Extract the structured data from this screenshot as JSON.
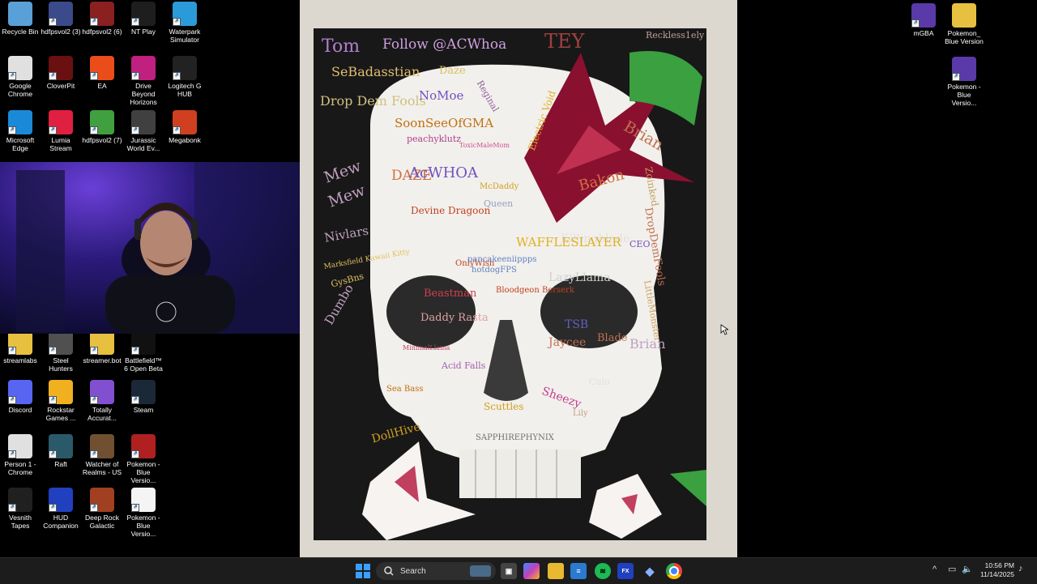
{
  "desktop_left": [
    {
      "label": "Recycle Bin",
      "icon": "recycle-bin-icon",
      "color": "#5aa0d8"
    },
    {
      "label": "hdfpsvol2 (3)",
      "icon": "computer-icon",
      "color": "#3b4a8a"
    },
    {
      "label": "hdfpsvol2 (6)",
      "icon": "ninja-icon",
      "color": "#8a2020"
    },
    {
      "label": "NT Play",
      "icon": "nt-play-icon",
      "color": "#1e1e1e"
    },
    {
      "label": "Waterpark Simulator",
      "icon": "waterpark-icon",
      "color": "#2a9ad8"
    },
    {
      "label": "Google Chrome",
      "icon": "chrome-icon",
      "color": "#e0e0e0"
    },
    {
      "label": "CloverPit",
      "icon": "cloverpit-icon",
      "color": "#6a1010"
    },
    {
      "label": "EA",
      "icon": "ea-icon",
      "color": "#ea4d1a"
    },
    {
      "label": "Drive Beyond Horizons",
      "icon": "drive-beyond-icon",
      "color": "#c02080"
    },
    {
      "label": "Logitech G HUB",
      "icon": "logitech-icon",
      "color": "#222222"
    },
    {
      "label": "Microsoft Edge",
      "icon": "edge-icon",
      "color": "#1a8ad8"
    },
    {
      "label": "Lumia Stream",
      "icon": "lumia-icon",
      "color": "#e02040"
    },
    {
      "label": "hdfpsvol2 (7)",
      "icon": "dragon-icon",
      "color": "#40a040"
    },
    {
      "label": "Jurassic World Ev...",
      "icon": "jurassic-icon",
      "color": "#404040"
    },
    {
      "label": "Megabonk",
      "icon": "megabonk-icon",
      "color": "#d04020"
    },
    {
      "label": "streamlabs",
      "icon": "folder-icon",
      "color": "#e8c040"
    },
    {
      "label": "Steel Hunters",
      "icon": "steel-hunters-icon",
      "color": "#505050"
    },
    {
      "label": "streamer.bot",
      "icon": "folder-icon",
      "color": "#e8c040"
    },
    {
      "label": "Battlefield™ 6 Open Beta",
      "icon": "battlefield-icon",
      "color": "#111111"
    },
    {
      "label": "Discord",
      "icon": "discord-icon",
      "color": "#5865f2"
    },
    {
      "label": "Rockstar Games ...",
      "icon": "rockstar-icon",
      "color": "#f0b020"
    },
    {
      "label": "Totally Accurat...",
      "icon": "tabs-icon",
      "color": "#8050d0"
    },
    {
      "label": "Steam",
      "icon": "steam-icon",
      "color": "#1b2838"
    },
    {
      "label": "Person 1 - Chrome",
      "icon": "chrome-person-icon",
      "color": "#e0e0e0"
    },
    {
      "label": "Raft",
      "icon": "raft-icon",
      "color": "#2a5a6a"
    },
    {
      "label": "Watcher of Realms - US",
      "icon": "watcher-icon",
      "color": "#705030"
    },
    {
      "label": "Pokemon - Blue Versio...",
      "icon": "apex-icon",
      "color": "#b02020"
    },
    {
      "label": "Vesnith Tapes",
      "icon": "vesnith-icon",
      "color": "#202020"
    },
    {
      "label": "HUD Companion",
      "icon": "hud-icon",
      "color": "#2040c0"
    },
    {
      "label": "Deep Rock Galactic",
      "icon": "deep-rock-icon",
      "color": "#a04020"
    },
    {
      "label": "Pokemon - Blue Versio...",
      "icon": "file-icon",
      "color": "#f4f4f4"
    }
  ],
  "desktop_right": [
    {
      "label": "mGBA",
      "icon": "gba-icon",
      "color": "#5a3aa8"
    },
    {
      "label": "Pokemon_ Blue Version",
      "icon": "folder-icon",
      "color": "#e8c040"
    },
    {
      "label": "Pokemon - Blue Versio...",
      "icon": "gba-icon",
      "color": "#5a3aa8"
    }
  ],
  "painting": {
    "signatures": [
      "Tom",
      "Follow @ACWhoa",
      "TEY",
      "Reckless1ely",
      "SeBadasstian",
      "Daze",
      "Reginal",
      "Drop Dem Fools",
      "NoMoe",
      "SoonSeeOfGMA",
      "peachyklutz",
      "ToxicMaleMom",
      "DAZE",
      "AcWHOA",
      "Devine Dragoon",
      "McDaddy",
      "Queen",
      "Electric Void",
      "Bakon",
      "CEO",
      "Zoinked",
      "DropDemFools",
      "Brian",
      "Mew",
      "Mew",
      "Nivlars",
      "Killingblade",
      "WAFFLESLAYER",
      "OnlyWish",
      "pancakeeniippps",
      "hotdogFPS",
      "Marksfield Kawaii Kitty",
      "GysBns",
      "LazyLlama",
      "LittleMonster",
      "Bloodgeon Berserk",
      "Beastman",
      "Daddy Rasta",
      "MinimalLlama",
      "TSB",
      "Jaycee",
      "Blade",
      "Acid Falls",
      "Sea Bass",
      "Sheezy",
      "Scuttles",
      "SAPPHIREPHYNIX",
      "DollHive",
      "Culo",
      "Lily",
      "Brian",
      "Dumbo"
    ]
  },
  "taskbar": {
    "search_placeholder": "Search",
    "time": "10:56 PM",
    "date": "11/14/2025"
  }
}
